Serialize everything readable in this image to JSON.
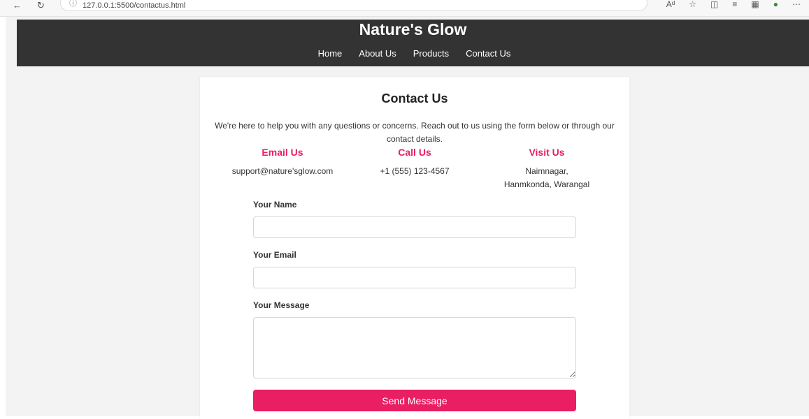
{
  "browser": {
    "url": "127.0.0.1:5500/contactus.html",
    "icons": [
      "back-icon",
      "refresh-icon",
      "info-icon",
      "read-aloud-icon",
      "favorite-icon",
      "split-screen-icon",
      "favorites-bar-icon",
      "collections-icon",
      "extension-icon",
      "more-icon"
    ]
  },
  "header": {
    "title": "Nature's Glow",
    "nav": [
      {
        "label": "Home"
      },
      {
        "label": "About Us"
      },
      {
        "label": "Products"
      },
      {
        "label": "Contact Us"
      }
    ]
  },
  "contact": {
    "heading": "Contact Us",
    "intro": "We're here to help you with any questions or concerns. Reach out to us using the form below or through our contact details.",
    "email": {
      "title": "Email Us",
      "value": "support@nature'sglow.com"
    },
    "call": {
      "title": "Call Us",
      "value": "+1 (555) 123-4567"
    },
    "visit": {
      "title": "Visit Us",
      "value": "Naimnagar, Hanmkonda, Warangal"
    }
  },
  "form": {
    "name_label": "Your Name",
    "name_value": "",
    "email_label": "Your Email",
    "email_value": "",
    "message_label": "Your Message",
    "message_value": "",
    "submit_label": "Send Message"
  },
  "colors": {
    "accent": "#e91e63",
    "header_bg": "#333333",
    "page_bg": "#f3f3f3"
  }
}
